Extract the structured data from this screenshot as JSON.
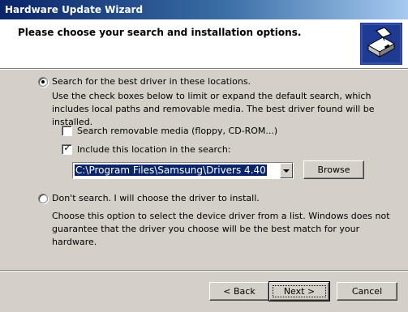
{
  "window": {
    "title": "Hardware Update Wizard"
  },
  "header": {
    "title": "Please choose your search and installation options.",
    "icon": "wizard-hardware-icon"
  },
  "options": {
    "search": {
      "label": "Search for the best driver in these locations.",
      "selected": true
    },
    "search_description": "Use the check boxes below to limit or expand the default search, which includes local paths and removable media. The best driver found will be installed.",
    "removable_media": {
      "label": "Search removable media (floppy, CD-ROM...)",
      "checked": false
    },
    "include_location": {
      "label": "Include this location in the search:",
      "checked": true
    },
    "location_value": "C:\\Program Files\\Samsung\\Drivers 4.40",
    "browse_label": "Browse",
    "dont_search": {
      "label": "Don't search. I will choose the driver to install.",
      "selected": false
    },
    "dont_search_description": "Choose this option to select the device driver from a list.  Windows does not guarantee that the driver you choose will be the best match for your hardware."
  },
  "footer": {
    "back_label": "< Back",
    "next_label": "Next >",
    "cancel_label": "Cancel"
  },
  "colors": {
    "titlebar_start": "#0a246a",
    "titlebar_end": "#a6caf0",
    "dialog_bg": "#d4d0c8",
    "selection": "#0a246a"
  }
}
